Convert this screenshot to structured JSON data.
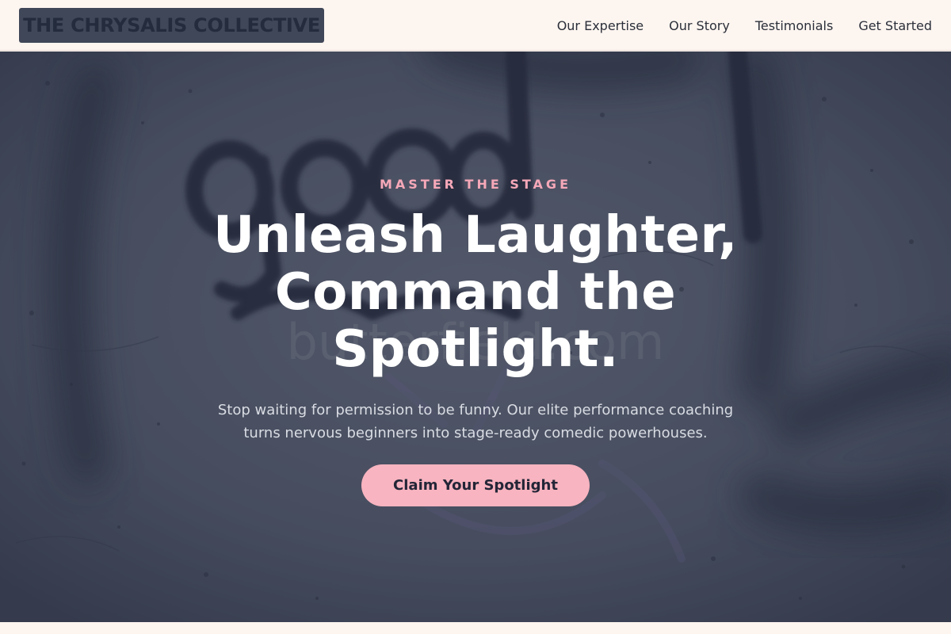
{
  "brand": {
    "logo_text": "THE CHRYSALIS COLLECTIVE"
  },
  "nav": {
    "items": [
      {
        "label": "Our Expertise"
      },
      {
        "label": "Our Story"
      },
      {
        "label": "Testimonials"
      },
      {
        "label": "Get Started"
      }
    ]
  },
  "hero": {
    "eyebrow": "MASTER THE STAGE",
    "headline": "Unleash Laughter, Command the Spotlight.",
    "subtext": "Stop waiting for permission to be funny. Our elite performance coaching turns nervous beginners into stage-ready comedic powerhouses.",
    "cta_label": "Claim Your Spotlight",
    "background_image": {
      "watermark_text": "butterfield.com"
    }
  },
  "colors": {
    "page_bg": "#fdf5f0",
    "logo_bg": "#3f4758",
    "logo_text": "#232b3c",
    "accent_pink": "#f8b4c0",
    "eyebrow_pink": "#f5a8b8",
    "hero_text": "#ffffff"
  }
}
